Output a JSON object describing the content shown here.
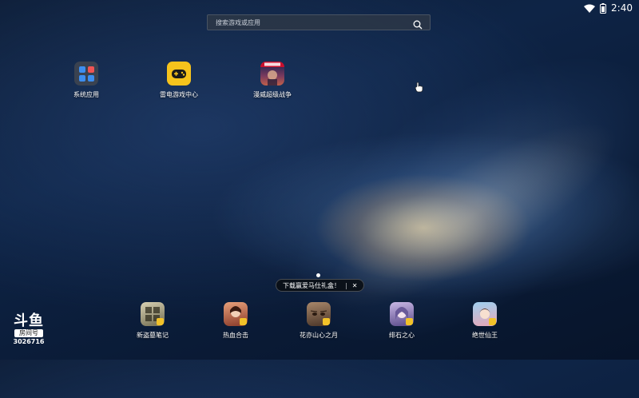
{
  "status_bar": {
    "time": "2:40",
    "icons": [
      "wifi-icon",
      "battery-icon"
    ]
  },
  "search": {
    "placeholder": "搜索游戏或应用",
    "icon": "search-icon"
  },
  "desktop_apps": [
    {
      "label": "系统应用",
      "icon": "app-folder-icon"
    },
    {
      "label": "雷电游戏中心",
      "icon": "gamepad-icon",
      "color": "#f6c31c"
    },
    {
      "label": "漫威超级战争",
      "icon": "marvel-game-icon",
      "color": "#c8102e"
    }
  ],
  "promo_banner": {
    "text": "下载赢爱马仕礼盒！",
    "close": "✕"
  },
  "dock_apps": [
    {
      "label": "新盗墓笔记",
      "icon": "tomb-notes-game-icon"
    },
    {
      "label": "热血合击",
      "icon": "hot-blood-game-icon"
    },
    {
      "label": "花亦山心之月",
      "icon": "flower-moon-game-icon"
    },
    {
      "label": "绯石之心",
      "icon": "scarlet-stone-game-icon"
    },
    {
      "label": "绝世仙王",
      "icon": "immortal-king-game-icon"
    }
  ],
  "watermark": {
    "logo": "斗鱼",
    "room_label": "房间号",
    "room_id": "3026716"
  }
}
